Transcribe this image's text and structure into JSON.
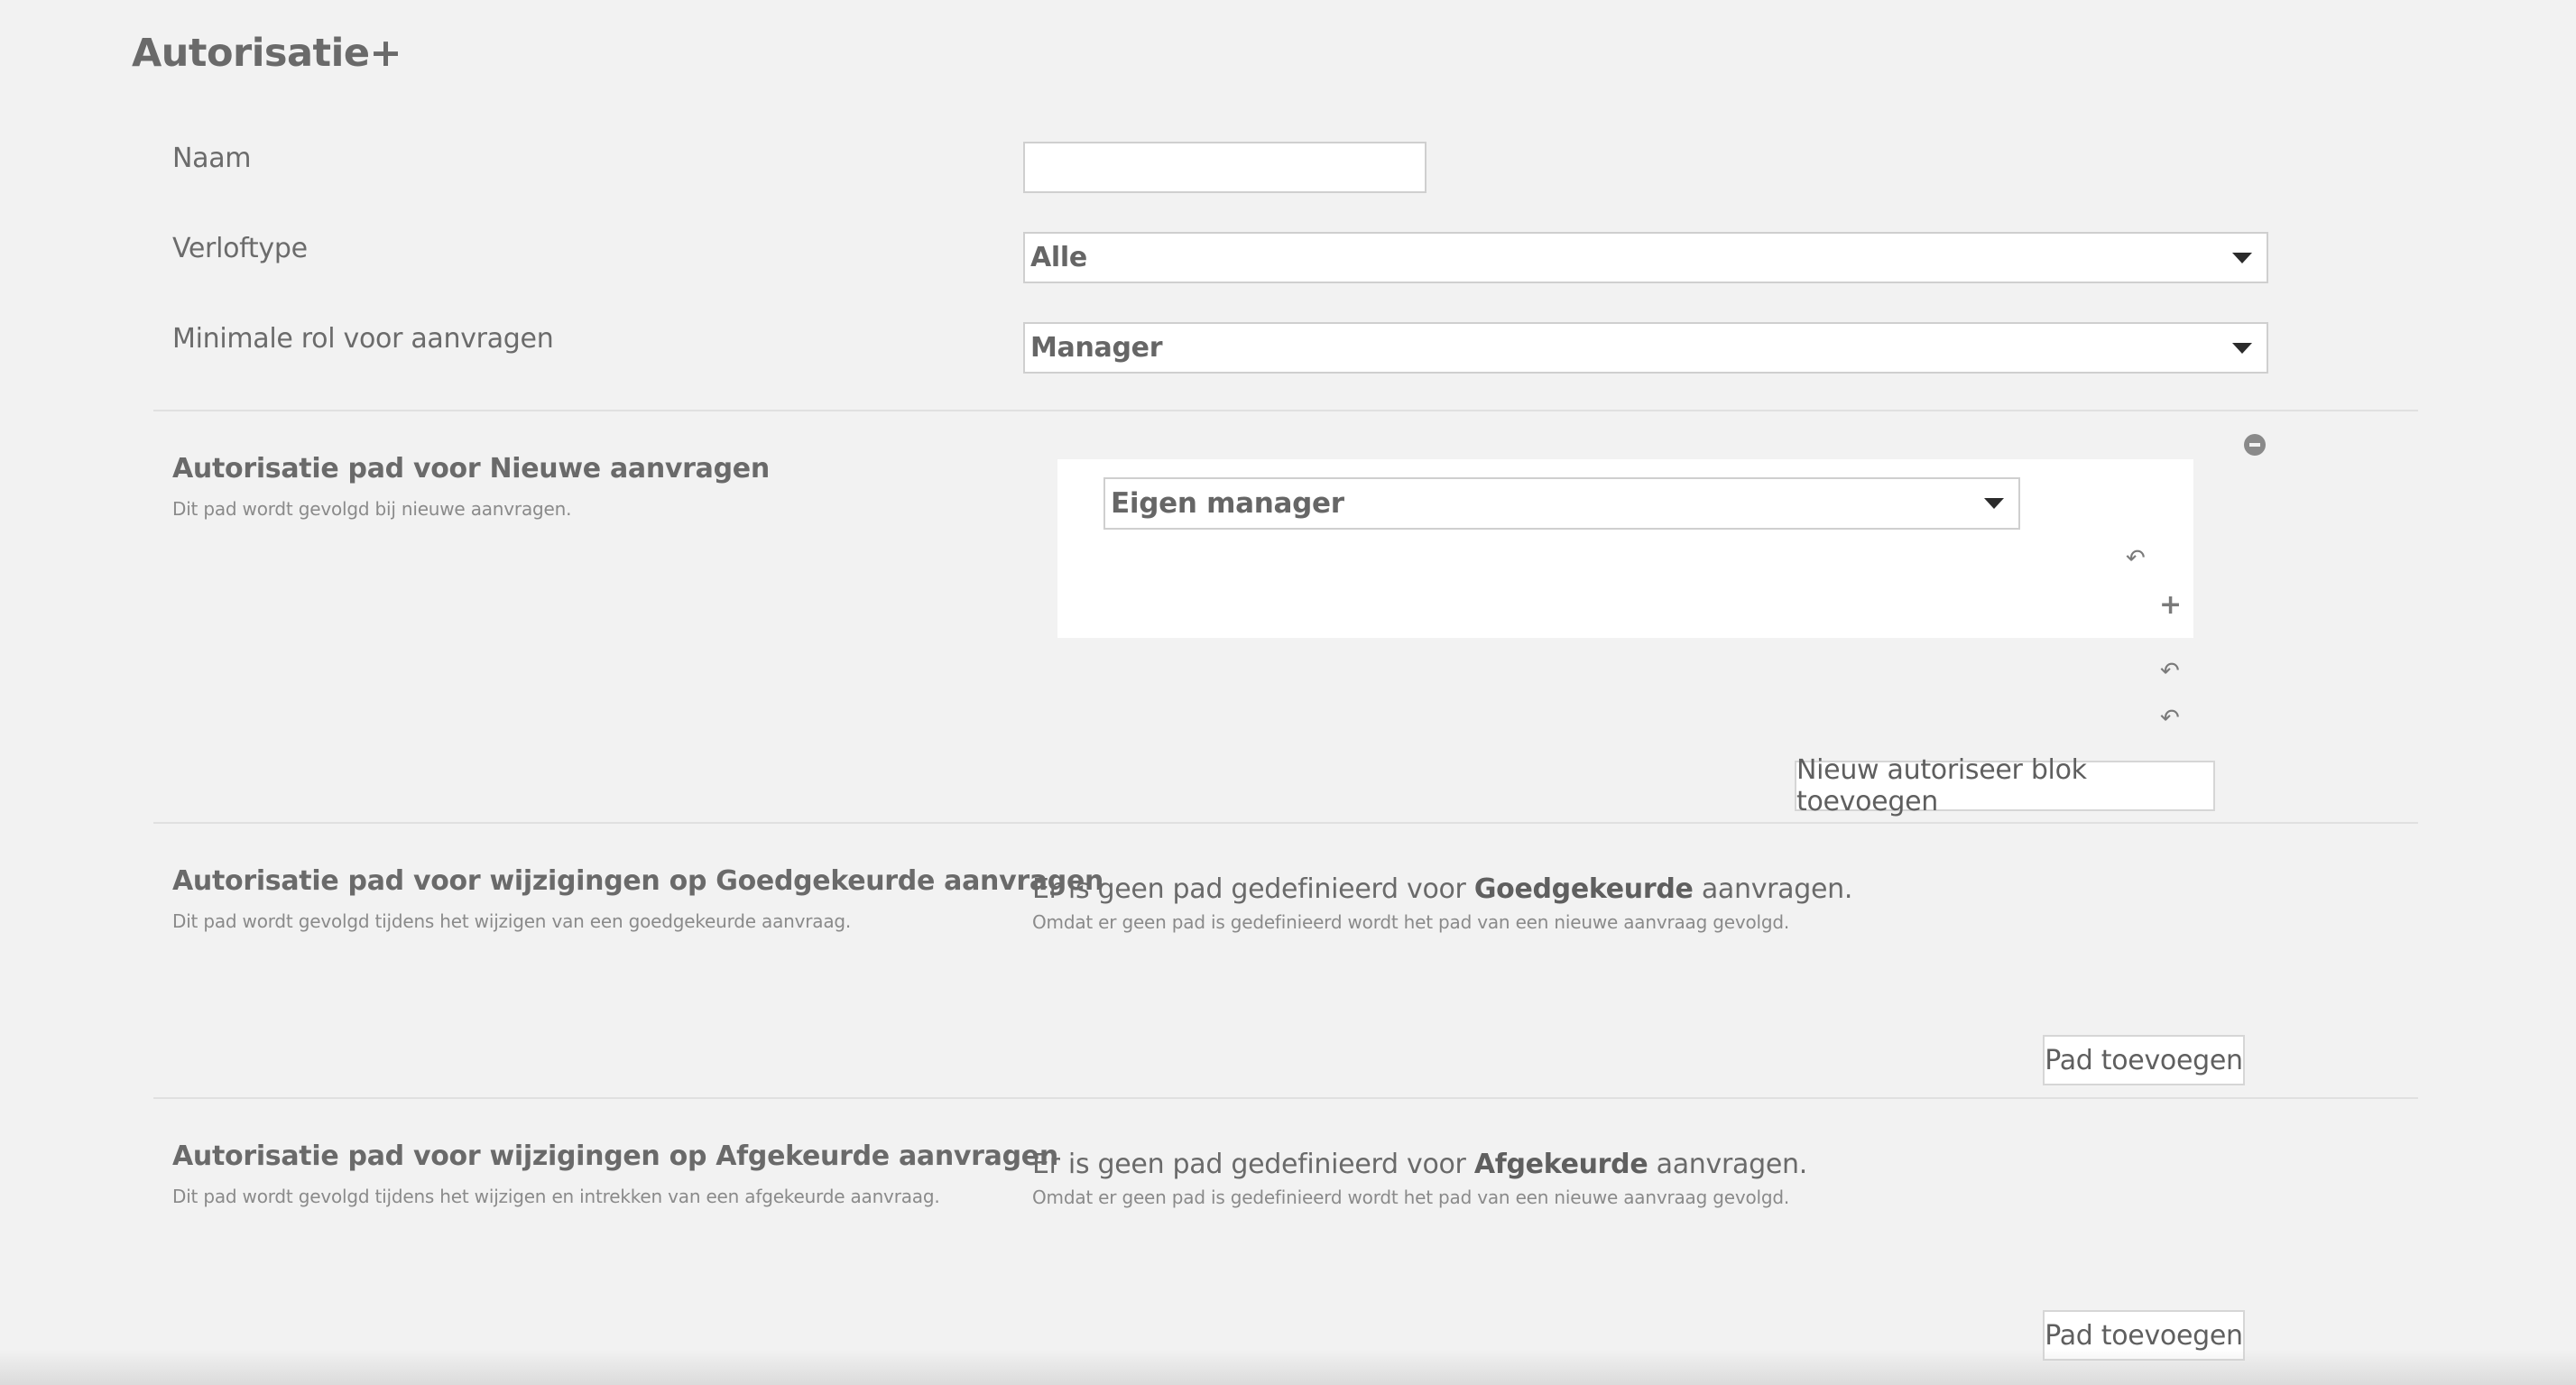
{
  "page": {
    "title": "Autorisatie+"
  },
  "form": {
    "name_label": "Naam",
    "name_value": "",
    "leave_type_label": "Verloftype",
    "leave_type_value": "Alle",
    "min_role_label": "Minimale rol voor aanvragen",
    "min_role_value": "Manager"
  },
  "sections": {
    "new": {
      "title": "Autorisatie pad voor Nieuwe aanvragen",
      "subtitle": "Dit pad wordt gevolgd bij nieuwe aanvragen.",
      "approver_value": "Eigen manager",
      "add_block_label": "Nieuw autoriseer blok toevoegen"
    },
    "approved": {
      "title": "Autorisatie pad voor wijzigingen op Goedgekeurde aanvragen",
      "subtitle": "Dit pad wordt gevolgd tijdens het wijzigen van een goedgekeurde aanvraag.",
      "msg_prefix": "Er is geen pad gedefinieerd voor ",
      "msg_bold": "Goedgekeurde",
      "msg_suffix": " aanvragen.",
      "msg_sub": "Omdat er geen pad is gedefinieerd wordt het pad van een nieuwe aanvraag gevolgd.",
      "add_path_label": "Pad toevoegen"
    },
    "rejected": {
      "title": "Autorisatie pad voor wijzigingen op Afgekeurde aanvragen",
      "subtitle": "Dit pad wordt gevolgd tijdens het wijzigen en intrekken van een afgekeurde aanvraag.",
      "msg_prefix": "Er is geen pad gedefinieerd voor ",
      "msg_bold": "Afgekeurde",
      "msg_suffix": " aanvragen.",
      "msg_sub": "Omdat er geen pad is gedefinieerd wordt het pad van een nieuwe aanvraag gevolgd.",
      "add_path_label": "Pad toevoegen"
    }
  },
  "icons": {
    "collapse": "minus-circle-icon",
    "undo": "undo-arrow-icon",
    "add": "plus-icon",
    "dropdown": "caret-down-icon"
  }
}
